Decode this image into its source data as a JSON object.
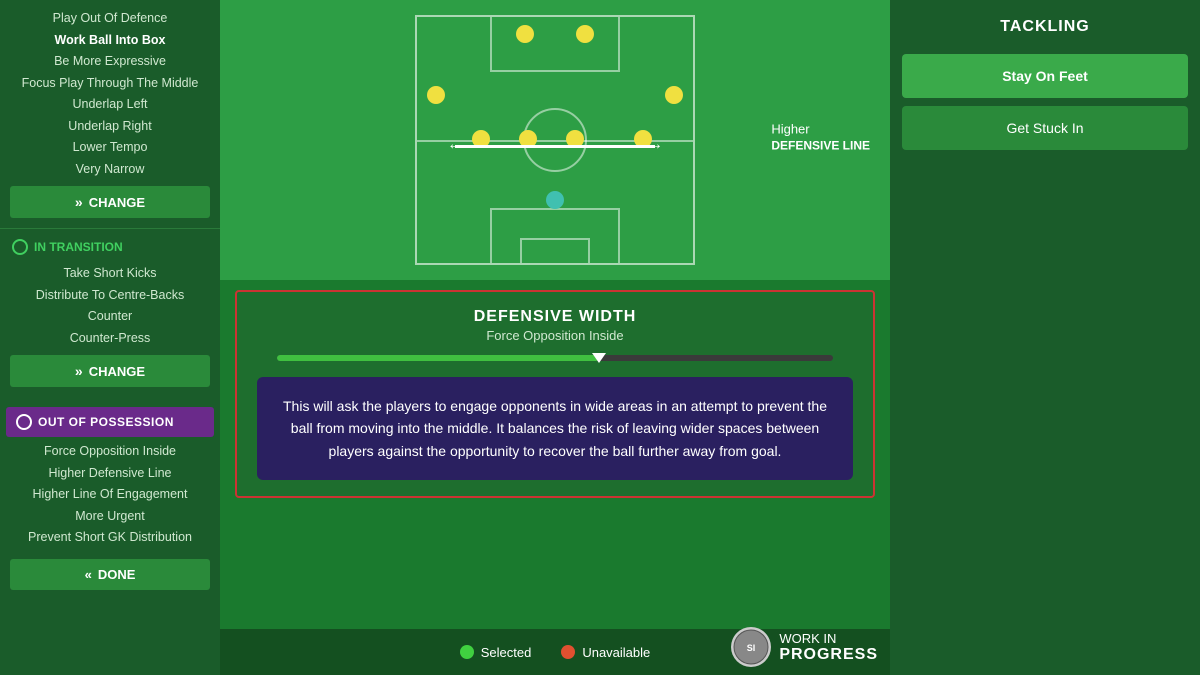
{
  "sidebar": {
    "in_possession_items": [
      "Play Out Of Defence",
      "Work Ball Into Box",
      "Be More Expressive",
      "Focus Play Through The Middle",
      "Underlap Left",
      "Underlap Right",
      "Lower Tempo",
      "Very Narrow"
    ],
    "change_label": "CHANGE",
    "in_transition_label": "IN TRANSITION",
    "in_transition_items": [
      "Take Short Kicks",
      "Distribute To Centre-Backs",
      "Counter",
      "Counter-Press"
    ],
    "change2_label": "CHANGE",
    "out_of_possession_label": "OUT OF POSSESSION",
    "out_possession_items": [
      "Force Opposition Inside",
      "Higher Defensive Line",
      "Higher Line Of Engagement",
      "More Urgent",
      "Prevent Short GK Distribution"
    ],
    "done_label": "DONE"
  },
  "pitch": {
    "defensive_line_label": "Higher",
    "defensive_line_bold": "DEFENSIVE LINE"
  },
  "main": {
    "defensive_width_title": "DEFENSIVE WIDTH",
    "defensive_width_subtitle": "Force Opposition Inside",
    "slider_percent": 58,
    "description": "This will ask the players to engage opponents in wide areas in an attempt to prevent the ball from moving into the middle. It balances the risk of leaving wider spaces between players against the opportunity to recover the ball further away from goal."
  },
  "legend": {
    "selected_label": "Selected",
    "unavailable_label": "Unavailable"
  },
  "right_panel": {
    "tackling_title": "TACKLING",
    "stay_on_feet_label": "Stay On Feet",
    "get_stuck_in_label": "Get Stuck In"
  },
  "wip": {
    "line1": "WORK IN",
    "line2": "PROGRESS"
  }
}
